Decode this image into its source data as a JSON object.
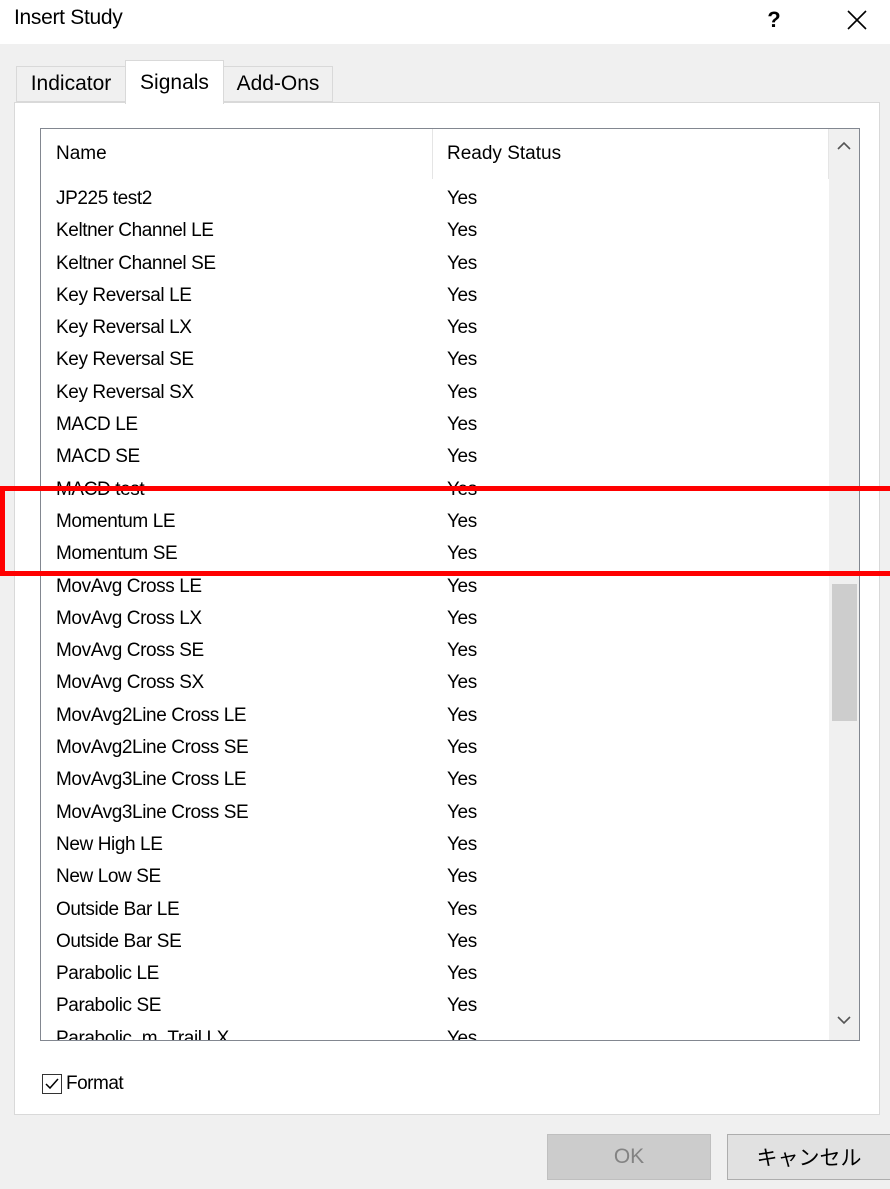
{
  "window": {
    "title": "Insert Study",
    "help_label": "?"
  },
  "tabs": [
    {
      "label": "Indicator",
      "active": false
    },
    {
      "label": "Signals",
      "active": true
    },
    {
      "label": "Add-Ons",
      "active": false
    }
  ],
  "list": {
    "columns": [
      "Name",
      "Ready Status"
    ],
    "rows": [
      {
        "name": "JP225 test2",
        "status": "Yes"
      },
      {
        "name": "Keltner Channel LE",
        "status": "Yes"
      },
      {
        "name": "Keltner Channel SE",
        "status": "Yes"
      },
      {
        "name": "Key Reversal LE",
        "status": "Yes"
      },
      {
        "name": "Key Reversal LX",
        "status": "Yes"
      },
      {
        "name": "Key Reversal SE",
        "status": "Yes"
      },
      {
        "name": "Key Reversal SX",
        "status": "Yes"
      },
      {
        "name": "MACD LE",
        "status": "Yes"
      },
      {
        "name": "MACD SE",
        "status": "Yes"
      },
      {
        "name": "MACD test",
        "status": "Yes"
      },
      {
        "name": "Momentum LE",
        "status": "Yes"
      },
      {
        "name": "Momentum SE",
        "status": "Yes"
      },
      {
        "name": "MovAvg Cross LE",
        "status": "Yes"
      },
      {
        "name": "MovAvg Cross LX",
        "status": "Yes"
      },
      {
        "name": "MovAvg Cross SE",
        "status": "Yes"
      },
      {
        "name": "MovAvg Cross SX",
        "status": "Yes"
      },
      {
        "name": "MovAvg2Line Cross LE",
        "status": "Yes"
      },
      {
        "name": "MovAvg2Line Cross SE",
        "status": "Yes"
      },
      {
        "name": "MovAvg3Line Cross LE",
        "status": "Yes"
      },
      {
        "name": "MovAvg3Line Cross SE",
        "status": "Yes"
      },
      {
        "name": "New High LE",
        "status": "Yes"
      },
      {
        "name": "New Low SE",
        "status": "Yes"
      },
      {
        "name": "Outside Bar LE",
        "status": "Yes"
      },
      {
        "name": "Outside Bar SE",
        "status": "Yes"
      },
      {
        "name": "Parabolic LE",
        "status": "Yes"
      },
      {
        "name": "Parabolic SE",
        "status": "Yes"
      },
      {
        "name": "Parabolic_m_Trail LX",
        "status": "Yes"
      }
    ]
  },
  "format": {
    "label": "Format",
    "checked": true
  },
  "buttons": {
    "ok": "OK",
    "cancel": "キャンセル"
  },
  "colors": {
    "highlight": "#ff0000",
    "disabled_text": "#838383"
  }
}
